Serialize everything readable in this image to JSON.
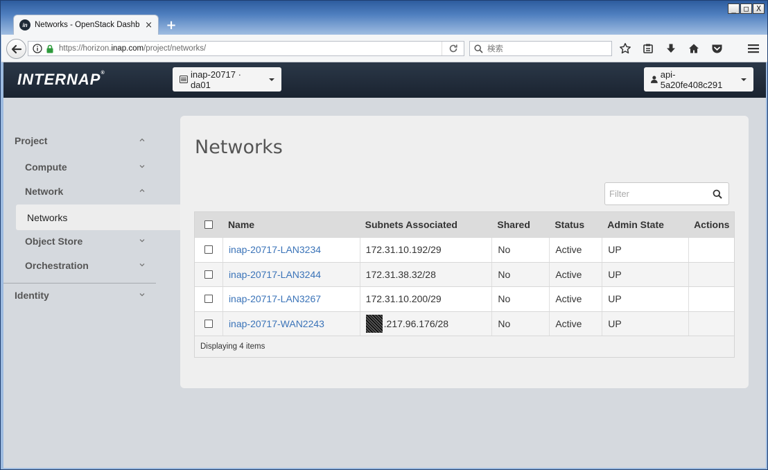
{
  "browser": {
    "window_controls": {
      "minimize": "_",
      "maximize": "□",
      "close": "X"
    },
    "tab": {
      "title": "Networks - OpenStack Dashb",
      "close": "×"
    },
    "new_tab": "+",
    "url": {
      "prefix": "https://horizon.",
      "domain": "inap.com",
      "path": "/project/networks/"
    },
    "search_placeholder": "検索"
  },
  "header": {
    "logo": "INTERNAP",
    "project_dropdown": "inap-20717 · da01",
    "user_dropdown": "api-5a20fe408c291"
  },
  "sidebar": {
    "project": "Project",
    "compute": "Compute",
    "network": "Network",
    "networks": "Networks",
    "object_store": "Object Store",
    "orchestration": "Orchestration",
    "identity": "Identity"
  },
  "page": {
    "title": "Networks",
    "filter_placeholder": "Filter"
  },
  "table": {
    "columns": [
      "Name",
      "Subnets Associated",
      "Shared",
      "Status",
      "Admin State",
      "Actions"
    ],
    "rows": [
      {
        "name": "inap-20717-LAN3234",
        "subnet": "172.31.10.192/29",
        "shared": "No",
        "status": "Active",
        "admin_state": "UP"
      },
      {
        "name": "inap-20717-LAN3244",
        "subnet": "172.31.38.32/28",
        "shared": "No",
        "status": "Active",
        "admin_state": "UP"
      },
      {
        "name": "inap-20717-LAN3267",
        "subnet": "172.31.10.200/29",
        "shared": "No",
        "status": "Active",
        "admin_state": "UP"
      },
      {
        "name": "inap-20717-WAN2243",
        "subnet": ".217.96.176/28",
        "shared": "No",
        "status": "Active",
        "admin_state": "UP"
      }
    ],
    "footer": "Displaying 4 items"
  },
  "colors": {
    "link": "#3a73b8",
    "header_bg": "#1f2a36",
    "content_bg": "#d5d9de",
    "panel_bg": "#efefef"
  }
}
